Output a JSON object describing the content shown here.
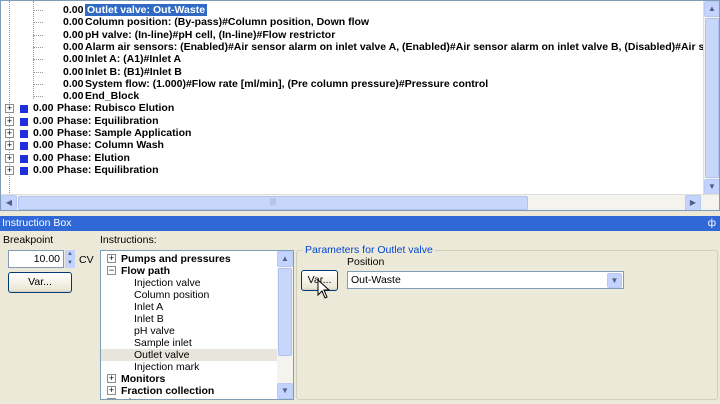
{
  "tree": {
    "rows": [
      {
        "time": "0.00",
        "text": "Outlet valve: Out-Waste",
        "selected": true
      },
      {
        "time": "0.00",
        "text": "Column position: (By-pass)#Column position, Down flow"
      },
      {
        "time": "0.00",
        "text": "pH valve: (In-line)#pH cell, (In-line)#Flow restrictor"
      },
      {
        "time": "0.00",
        "text": "Alarm air sensors: (Enabled)#Air sensor alarm on inlet valve A, (Enabled)#Air sensor alarm on inlet valve B, (Disabled)#Air se"
      },
      {
        "time": "0.00",
        "text": "Inlet A: (A1)#Inlet A"
      },
      {
        "time": "0.00",
        "text": "Inlet B: (B1)#Inlet B"
      },
      {
        "time": "0.00",
        "text": "System flow: (1.000)#Flow rate [ml/min], (Pre column pressure)#Pressure control"
      },
      {
        "time": "0.00",
        "text": "End_Block"
      }
    ],
    "phases": [
      {
        "time": "0.00",
        "text": "Phase: Rubisco Elution"
      },
      {
        "time": "0.00",
        "text": "Phase: Equilibration"
      },
      {
        "time": "0.00",
        "text": "Phase: Sample Application"
      },
      {
        "time": "0.00",
        "text": "Phase: Column Wash"
      },
      {
        "time": "0.00",
        "text": "Phase: Elution"
      },
      {
        "time": "0.00",
        "text": "Phase: Equilibration"
      }
    ]
  },
  "instruction_box": {
    "title": "Instruction Box",
    "pin": "ф",
    "breakpoint_label": "Breakpoint",
    "breakpoint_value": "10.00",
    "breakpoint_unit": "CV",
    "var_label": "Var...",
    "instructions_label": "Instructions:",
    "instructions": [
      {
        "text": "Pumps and pressures",
        "bold": true,
        "expander": "+"
      },
      {
        "text": "Flow path",
        "bold": true,
        "expander": "−"
      },
      {
        "text": "Injection valve"
      },
      {
        "text": "Column position"
      },
      {
        "text": "Inlet A"
      },
      {
        "text": "Inlet B"
      },
      {
        "text": "pH valve"
      },
      {
        "text": "Sample inlet"
      },
      {
        "text": "Outlet valve",
        "highlight": true
      },
      {
        "text": "Injection mark"
      },
      {
        "text": "Monitors",
        "bold": true,
        "expander": "+"
      },
      {
        "text": "Fraction collection",
        "bold": true,
        "expander": "+"
      },
      {
        "text": "Al...",
        "bold": true,
        "expander": "+"
      }
    ],
    "params_legend": "Parameters for Outlet valve",
    "position_label": "Position",
    "position_var_label": "Var...",
    "position_value": "Out-Waste"
  },
  "colors": {
    "selection": "#316ac5",
    "title_bar": "#3068d8",
    "phase_square": "#1f2fdb",
    "legend_text": "#0046d5"
  }
}
